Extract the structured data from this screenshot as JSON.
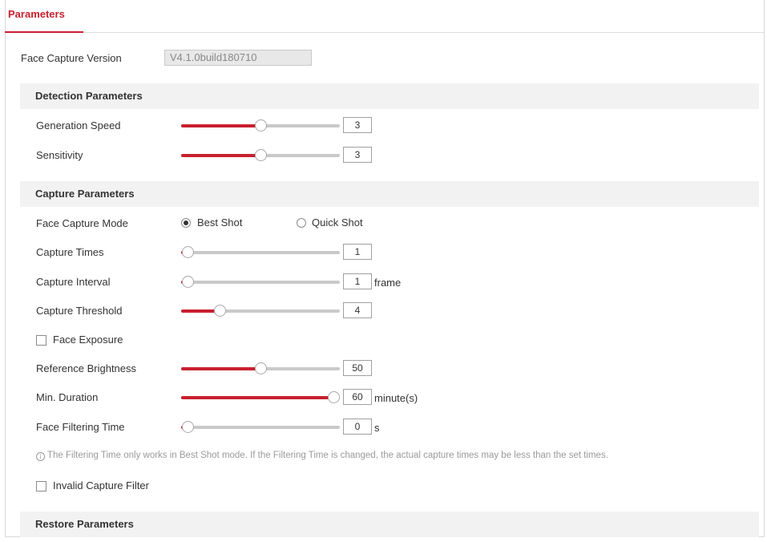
{
  "tab": {
    "label": "Parameters"
  },
  "version": {
    "label": "Face Capture Version",
    "value": "V4.1.0build180710"
  },
  "sections": {
    "detection": "Detection Parameters",
    "capture": "Capture Parameters",
    "restore": "Restore Parameters"
  },
  "detection": {
    "generation_speed": {
      "label": "Generation Speed",
      "value": "3",
      "fraction": 0.5
    },
    "sensitivity": {
      "label": "Sensitivity",
      "value": "3",
      "fraction": 0.5
    }
  },
  "capture": {
    "mode": {
      "label": "Face Capture Mode",
      "options": [
        "Best Shot",
        "Quick Shot"
      ],
      "selected": "Best Shot"
    },
    "times": {
      "label": "Capture Times",
      "value": "1",
      "fraction": 0.0
    },
    "interval": {
      "label": "Capture Interval",
      "value": "1",
      "unit": "frame",
      "fraction": 0.0
    },
    "threshold": {
      "label": "Capture Threshold",
      "value": "4",
      "fraction": 0.22
    },
    "face_exposure": {
      "label": "Face Exposure",
      "checked": false
    },
    "reference_brightness": {
      "label": "Reference Brightness",
      "value": "50",
      "fraction": 0.5
    },
    "min_duration": {
      "label": "Min. Duration",
      "value": "60",
      "unit": "minute(s)",
      "fraction": 1.0
    },
    "filtering_time": {
      "label": "Face Filtering Time",
      "value": "0",
      "unit": "s",
      "fraction": 0.0
    },
    "note": "The Filtering Time only works in Best Shot mode. If the Filtering Time is changed, the actual capture times may be less than the set times.",
    "invalid_filter": {
      "label": "Invalid Capture Filter",
      "checked": false
    }
  },
  "colors": {
    "accent": "#c8202f",
    "track": "#c9c9c9",
    "section_bg": "#f2f2f2"
  },
  "icons": {
    "info": "info-circle-icon"
  }
}
